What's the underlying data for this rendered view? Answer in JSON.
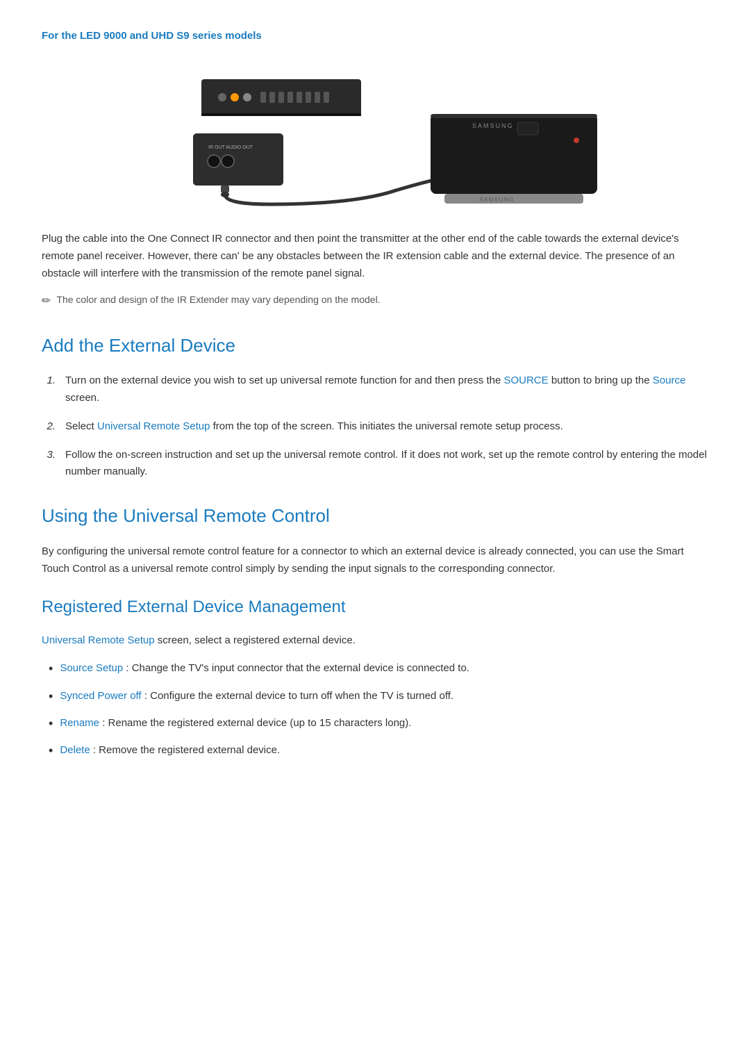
{
  "series_label": "For the LED 9000 and UHD S9 series models",
  "body_text": "Plug the cable into the One Connect IR connector and then point the transmitter at the other end of the cable towards the external device's remote panel receiver. However, there can' be any obstacles between the IR extension cable and the external device. The presence of an obstacle will interfere with the transmission of the remote panel signal.",
  "note_text": "The color and design of the IR Extender may vary depending on the model.",
  "add_device": {
    "title": "Add the External Device",
    "steps": [
      {
        "num": "1.",
        "text_before": "Turn on the external device you wish to set up universal remote function for and then press the ",
        "link1": "SOURCE",
        "text_mid": " button to bring up the ",
        "link2": "Source",
        "text_after": " screen."
      },
      {
        "num": "2.",
        "text_before": "Select ",
        "link1": "Universal Remote Setup",
        "text_after": " from the top of the screen. This initiates the universal remote setup process."
      },
      {
        "num": "3.",
        "text": "Follow the on-screen instruction and set up the universal remote control. If it does not work, set up the remote control by entering the model number manually."
      }
    ]
  },
  "using_remote": {
    "title": "Using the Universal Remote Control",
    "body": "By configuring the universal remote control feature for a connector to which an external device is already connected, you can use the Smart Touch Control as a universal remote control simply by sending the input signals to the corresponding connector."
  },
  "registered": {
    "title": "Registered External Device Management",
    "intro_link": "Universal Remote Setup",
    "intro_after": " screen, select a registered external device.",
    "items": [
      {
        "link": "Source Setup",
        "text": ": Change the TV's input connector that the external device is connected to."
      },
      {
        "link": "Synced Power off",
        "text": ": Configure the external device to turn off when the TV is turned off."
      },
      {
        "link": "Rename",
        "text": ": Rename the registered external device (up to 15 characters long)."
      },
      {
        "link": "Delete",
        "text": ": Remove the registered external device."
      }
    ]
  }
}
